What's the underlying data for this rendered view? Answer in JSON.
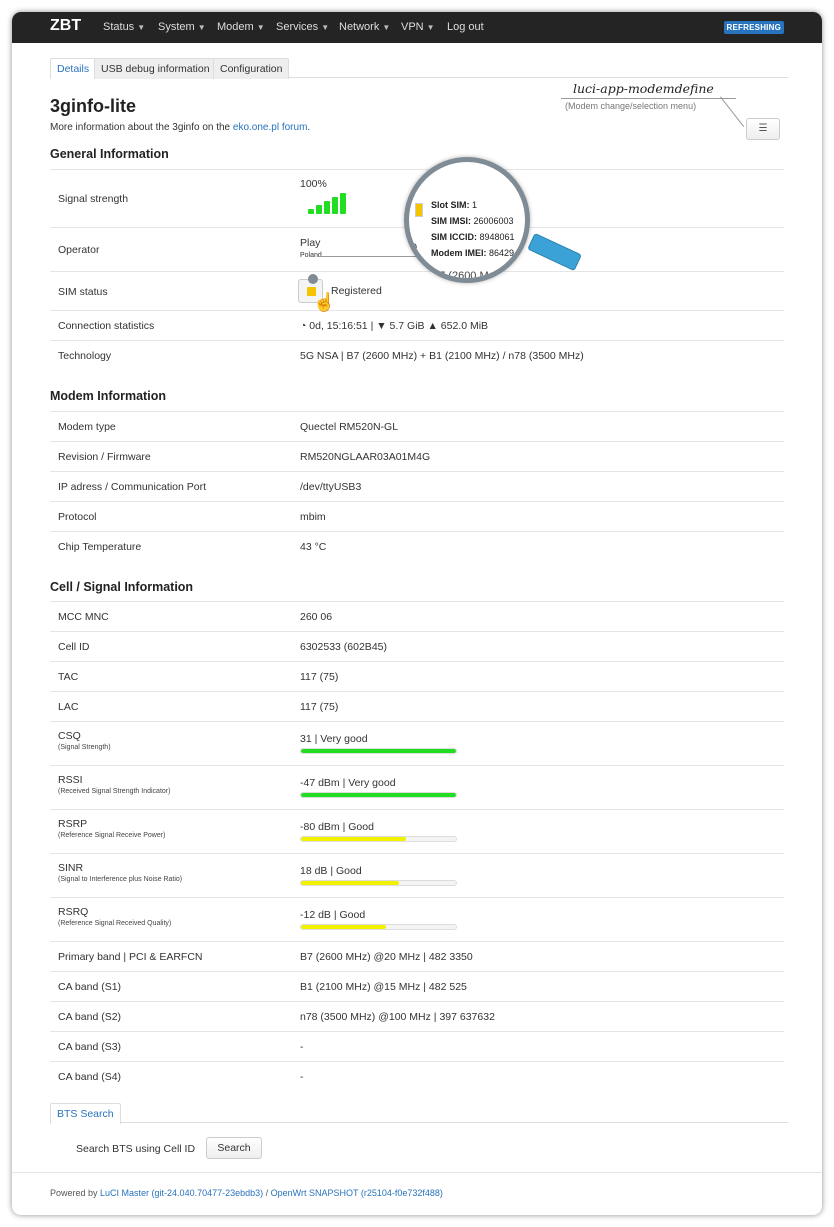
{
  "nav": {
    "brand": "ZBT",
    "items": [
      "Status",
      "System",
      "Modem",
      "Services",
      "Network",
      "VPN",
      "Log out"
    ],
    "badge": "REFRESHING"
  },
  "tabs": [
    "Details",
    "USB debug information",
    "Configuration"
  ],
  "page": {
    "title": "3ginfo-lite",
    "subtitle_prefix": "More information about the 3ginfo on the ",
    "subtitle_link": "eko.one.pl forum",
    "subtitle_suffix": "."
  },
  "annotation": {
    "title": "luci-app-modemdefine",
    "subtitle": "(Modem change/selection menu)",
    "menu_icon": "☰"
  },
  "general": {
    "title": "General Information",
    "signal_label": "Signal strength",
    "signal_value": "100%",
    "operator_label": "Operator",
    "operator_value": "Play",
    "operator_country": "Poland",
    "sim_label": "SIM status",
    "sim_value": "Registered",
    "conn_label": "Connection statistics",
    "conn_value": "0d, 15:16:51 | ▼ 5.7 GiB ▲ 652.0 MiB",
    "tech_label": "Technology",
    "tech_value": "5G NSA | B7 (2600 MHz) + B1 (2100 MHz) / n78 (3500 MHz)"
  },
  "magnifier": {
    "lines": [
      {
        "k": "Slot SIM:",
        "v": " 1"
      },
      {
        "k": "SIM IMSI:",
        "v": " 26006003"
      },
      {
        "k": "SIM ICCID:",
        "v": " 8948061"
      },
      {
        "k": "Modem IMEI:",
        "v": " 86429"
      }
    ],
    "peek_left": "0",
    "peek_bottom": "37 (2600 M"
  },
  "modem": {
    "title": "Modem Information",
    "rows": [
      {
        "k": "Modem type",
        "v": "Quectel RM520N-GL"
      },
      {
        "k": "Revision / Firmware",
        "v": "RM520NGLAAR03A01M4G"
      },
      {
        "k": "IP adress / Communication Port",
        "v": "/dev/ttyUSB3"
      },
      {
        "k": "Protocol",
        "v": "mbim"
      },
      {
        "k": "Chip Temperature",
        "v": "43 °C"
      }
    ]
  },
  "cell": {
    "title": "Cell / Signal Information",
    "rows_top": [
      {
        "k": "MCC MNC",
        "v": "260 06"
      },
      {
        "k": "Cell ID",
        "v": "6302533 (602B45)"
      },
      {
        "k": "TAC",
        "v": "117 (75)"
      },
      {
        "k": "LAC",
        "v": "117 (75)"
      }
    ],
    "meters": [
      {
        "k": "CSQ",
        "sub": "(Signal Strength)",
        "v": "31 | Very good",
        "level": 1.0,
        "color": "#22dd22"
      },
      {
        "k": "RSSI",
        "sub": "(Received Signal Strength Indicator)",
        "v": "-47 dBm | Very good",
        "level": 1.0,
        "color": "#22dd22"
      },
      {
        "k": "RSRP",
        "sub": "(Reference Signal Receive Power)",
        "v": "-80 dBm | Good",
        "level": 0.68,
        "color": "#f2f200"
      },
      {
        "k": "SINR",
        "sub": "(Signal to Interference plus Noise Ratio)",
        "v": "18 dB | Good",
        "level": 0.63,
        "color": "#f2f200"
      },
      {
        "k": "RSRQ",
        "sub": "(Reference Signal Received Quality)",
        "v": "-12 dB | Good",
        "level": 0.55,
        "color": "#f2f200"
      }
    ],
    "rows_bottom": [
      {
        "k": "Primary band | PCI & EARFCN",
        "v": "B7 (2600 MHz) @20 MHz | 482 3350"
      },
      {
        "k": "CA band (S1)",
        "v": "B1 (2100 MHz) @15 MHz | 482 525"
      },
      {
        "k": "CA band (S2)",
        "v": "n78 (3500 MHz) @100 MHz | 397 637632"
      },
      {
        "k": "CA band (S3)",
        "v": "-"
      },
      {
        "k": "CA band (S4)",
        "v": "-"
      }
    ]
  },
  "bts": {
    "tab": "BTS Search",
    "label": "Search BTS using Cell ID",
    "button": "Search"
  },
  "footer": {
    "prefix": "Powered by ",
    "link1": "LuCI Master (git-24.040.70477-23ebdb3)",
    "sep": " / ",
    "link2": "OpenWrt SNAPSHOT (r25104-f0e732f488)"
  },
  "colors": {
    "accent": "#2873bd",
    "navbar": "#242424",
    "good_green": "#22dd22",
    "good_yellow": "#f2f200"
  }
}
